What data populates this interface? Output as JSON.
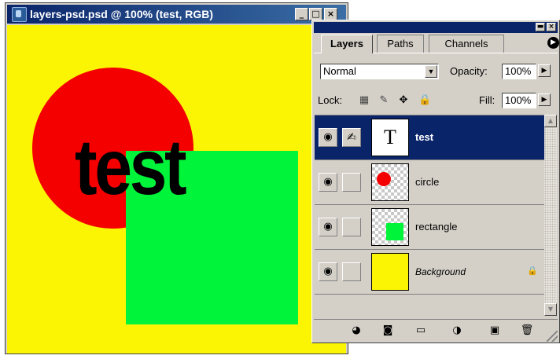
{
  "document": {
    "title": "layers-psd.psd @ 100% (test, RGB)",
    "canvas_text": "test",
    "colors": {
      "background": "#fbf503",
      "circle": "#f50000",
      "rectangle": "#00f53a"
    }
  },
  "palette": {
    "tabs": [
      {
        "label": "Layers",
        "active": true
      },
      {
        "label": "Paths",
        "active": false
      },
      {
        "label": "Channels",
        "active": false
      }
    ],
    "blend_mode": "Normal",
    "opacity_label": "Opacity:",
    "opacity_value": "100%",
    "lock_label": "Lock:",
    "fill_label": "Fill:",
    "fill_value": "100%",
    "thumb_text_glyph": "T",
    "layers": [
      {
        "name": "test",
        "type": "text",
        "selected": true
      },
      {
        "name": "circle",
        "type": "shape",
        "selected": false
      },
      {
        "name": "rectangle",
        "type": "shape",
        "selected": false
      },
      {
        "name": "Background",
        "type": "background",
        "selected": false,
        "locked": true
      }
    ],
    "footer_buttons": [
      "layer-style",
      "add-mask",
      "new-set",
      "adjustment-layer",
      "new-layer",
      "delete-layer"
    ]
  }
}
